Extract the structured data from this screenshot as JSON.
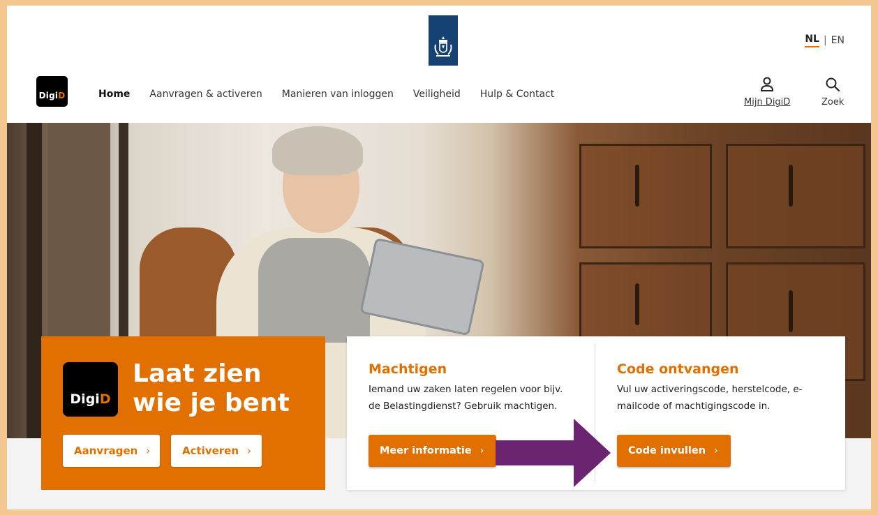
{
  "header": {
    "lang_active": "NL",
    "lang_separator": "|",
    "lang_other": "EN",
    "logo_text_a": "Digi",
    "logo_text_b": "D"
  },
  "nav": {
    "items": [
      {
        "label": "Home"
      },
      {
        "label": "Aanvragen & activeren"
      },
      {
        "label": "Manieren van inloggen"
      },
      {
        "label": "Veiligheid"
      },
      {
        "label": "Hulp & Contact"
      }
    ]
  },
  "top_actions": {
    "mijn_label": "Mijn DigiD",
    "zoek_label": "Zoek",
    "mijn_icon": "person-icon",
    "zoek_icon": "search-icon"
  },
  "hero_card": {
    "logo_text_a": "Digi",
    "logo_text_b": "D",
    "headline_line1": "Laat zien",
    "headline_line2": "wie je bent",
    "btn_aanvragen": "Aanvragen",
    "btn_activeren": "Activeren",
    "chevron": "›"
  },
  "info_card": {
    "machtigen_title": "Machtigen",
    "machtigen_text_1": "Iemand uw zaken laten regelen voor bijv.",
    "machtigen_text_2": "de Belastingdienst? Gebruik machtigen.",
    "machtigen_button": "Meer informatie",
    "code_title": "Code ontvangen",
    "code_text_1": "Vul uw activeringscode, herstelcode, e-",
    "code_text_2": "mailcode of machtigingscode in.",
    "code_button": "Code invullen"
  },
  "colors": {
    "brand_orange": "#e17000",
    "ribbon_blue": "#154273",
    "annotation_arrow": "#6b2470",
    "frame": "#f6c891"
  }
}
